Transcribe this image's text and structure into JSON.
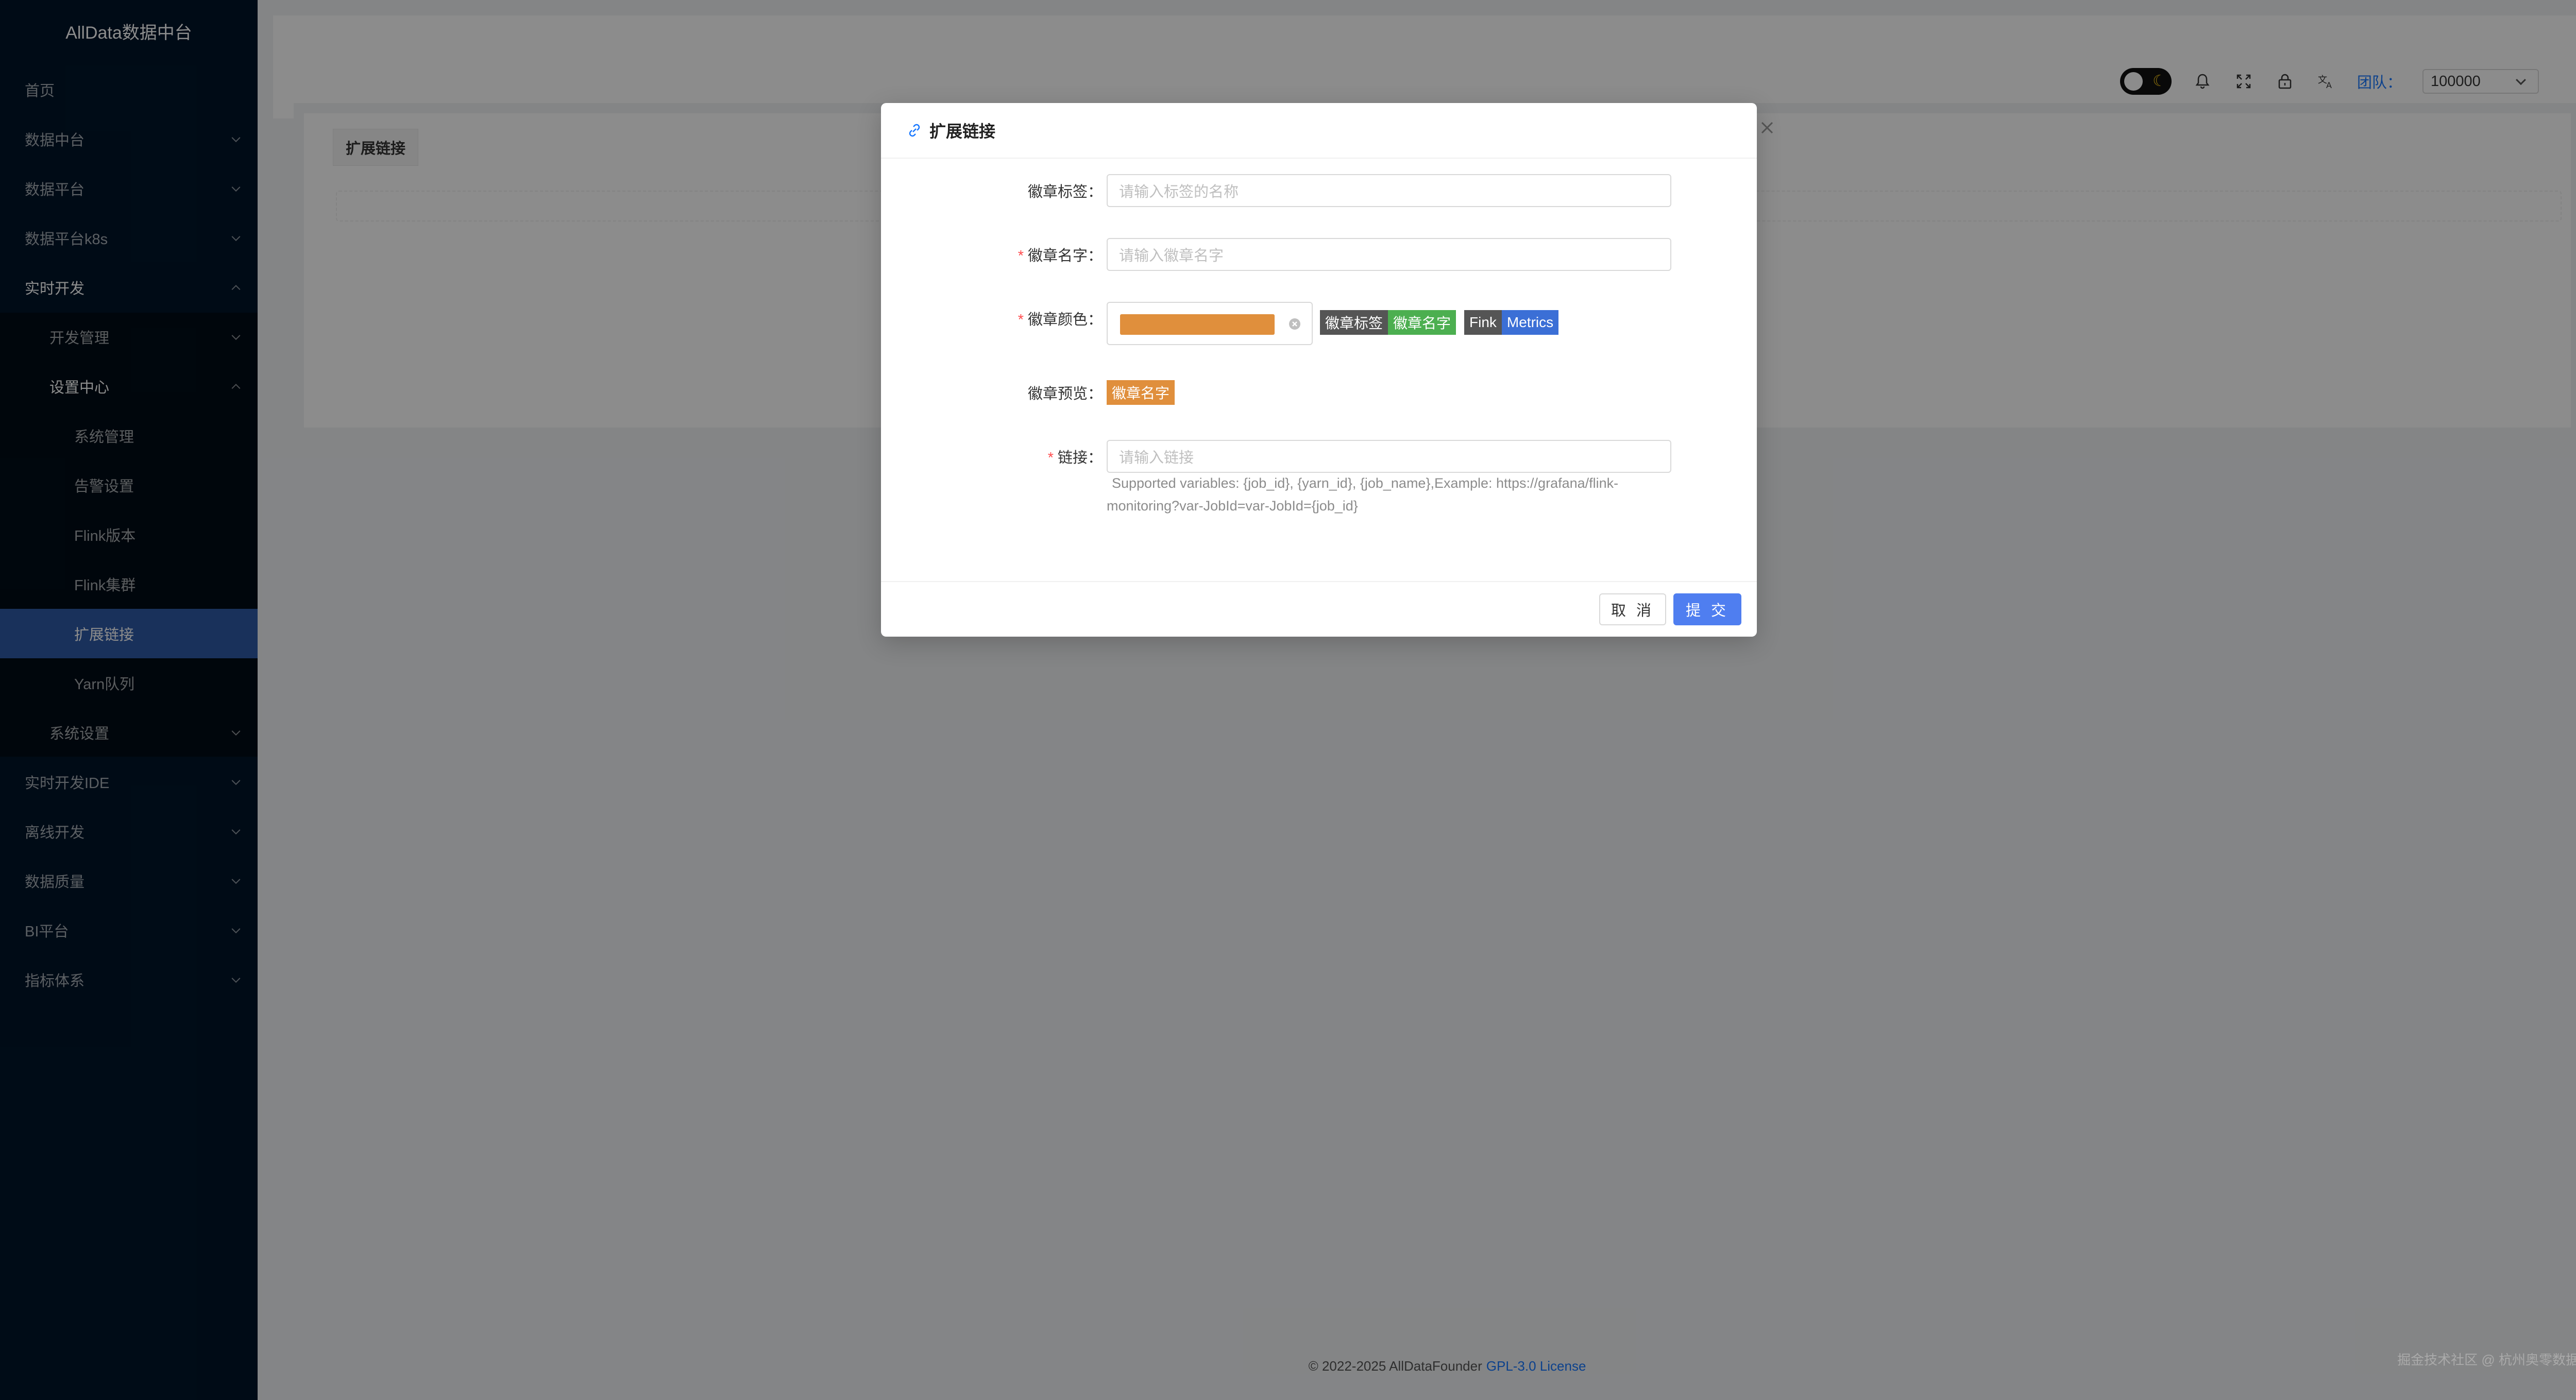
{
  "sidebar": {
    "logo": "AllData数据中台",
    "items": [
      {
        "label": "首页"
      },
      {
        "label": "数据中台"
      },
      {
        "label": "数据平台"
      },
      {
        "label": "数据平台k8s"
      },
      {
        "label": "实时开发"
      },
      {
        "label": "开发管理"
      },
      {
        "label": "设置中心"
      },
      {
        "label": "系统管理"
      },
      {
        "label": "告警设置"
      },
      {
        "label": "Flink版本"
      },
      {
        "label": "Flink集群"
      },
      {
        "label": "扩展链接"
      },
      {
        "label": "Yarn队列"
      },
      {
        "label": "系统设置"
      },
      {
        "label": "实时开发IDE"
      },
      {
        "label": "离线开发"
      },
      {
        "label": "数据质量"
      },
      {
        "label": "BI平台"
      },
      {
        "label": "指标体系"
      }
    ]
  },
  "header": {
    "team_label": "团队：",
    "team_value": "100000",
    "icons": [
      "theme-toggle",
      "bell-icon",
      "fullscreen-icon",
      "lock-icon",
      "translate-icon"
    ]
  },
  "page": {
    "tab_label": "扩展链接"
  },
  "modal": {
    "title": "扩展链接",
    "fields": {
      "badge_label": {
        "label": "徽章标签：",
        "placeholder": "请输入标签的名称"
      },
      "badge_name": {
        "label": "徽章名字：",
        "placeholder": "请输入徽章名字"
      },
      "badge_color": {
        "label": "徽章颜色：",
        "value": "#e08f3c"
      },
      "badge_preview": {
        "label": "徽章预览：",
        "value": "徽章名字"
      },
      "link": {
        "label": "链接：",
        "placeholder": "请输入链接"
      }
    },
    "sample_badges": {
      "first": {
        "left": "徽章标签",
        "right": "徽章名字",
        "left_color": "#555555",
        "right_color": "#4caf50"
      },
      "second": {
        "left": "Fink",
        "right": "Metrics",
        "left_color": "#555555",
        "right_color": "#3b6fd6"
      }
    },
    "help_line1": "Supported variables: {job_id}, {yarn_id}, {job_name},Example: https://grafana/flink-",
    "help_line2": "monitoring?var-JobId=var-JobId={job_id}",
    "cancel_label": "取 消",
    "submit_label": "提 交"
  },
  "footer": {
    "copyright": "© 2022-2025 AllDataFounder",
    "license": "GPL-3.0 License"
  },
  "watermark": "掘金技术社区 @ 杭州奥零数据科技"
}
